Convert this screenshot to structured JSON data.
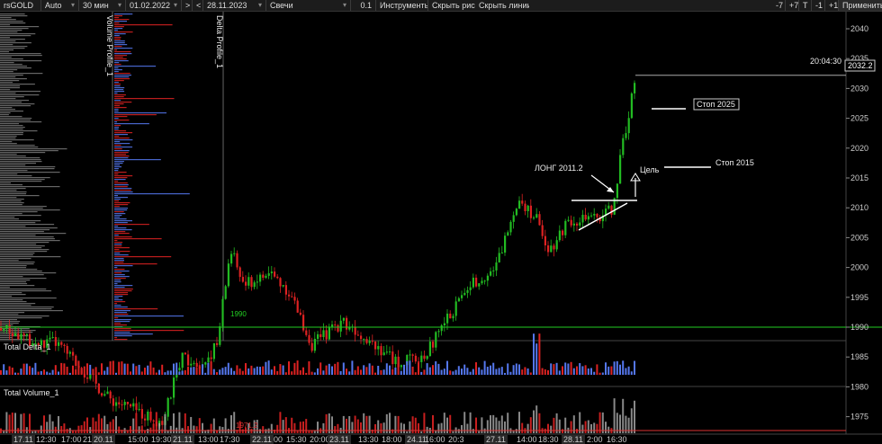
{
  "toolbar": {
    "symbol": "rsGOLD",
    "scale_mode": "Auto",
    "timeframe": "30 мин",
    "date_from": "01.02.2022",
    "nav_next": ">",
    "nav_prev": "<",
    "date_to": "28.11.2023",
    "chart_type": "Свечи",
    "step": "0.1",
    "tools": "Инструменты",
    "hide_drawings": "Скрыть рис.",
    "hide_lines": "Скрыть линии",
    "btn_m7": "-7",
    "btn_p7": "+7",
    "btn_t": "T",
    "btn_m1": "-1",
    "btn_p1": "+1",
    "apply": "Применить"
  },
  "panels": {
    "volume_profile": "Volume Profile_1",
    "delta_profile": "Delta Profile_1",
    "total_delta": "Total Delta_1",
    "total_volume": "Total Volume_1"
  },
  "chart_data": {
    "type": "candlestick",
    "y_ticks": [
      2040,
      2035,
      2030,
      2025,
      2020,
      2015,
      2010,
      2005,
      2000,
      1995,
      1990,
      1985,
      1980,
      1975
    ],
    "ylim": [
      1971.5,
      2041.5
    ],
    "x_ticks": [
      "17.11",
      "12:30",
      "17:00",
      "21",
      "20.11",
      "15:00",
      "19:30",
      "21.11",
      "13:00",
      "17:30",
      "22.11",
      "00",
      "15:30",
      "20:00",
      "23.11",
      "13:30",
      "18:00",
      "24.11",
      "16:00",
      "20:3",
      "27.11",
      "14:00",
      "18:30",
      "28.11",
      "2:00",
      "16:30"
    ],
    "current_price": "2032.2",
    "current_time": "20:04:30",
    "level_1990_label": "1990",
    "level_1971_label": "1971.2",
    "annotations": {
      "long": "ЛОНГ 2011.2",
      "target": "Цель",
      "stop_2025": "Стоп 2025",
      "stop_2015": "Стоп 2015"
    },
    "colors": {
      "up": "#22bb22",
      "down": "#dd2222",
      "level_line": "#22cc22",
      "volume_bar": "#aaaaaa",
      "delta_up": "#5577ee",
      "delta_down": "#dd2222"
    }
  }
}
